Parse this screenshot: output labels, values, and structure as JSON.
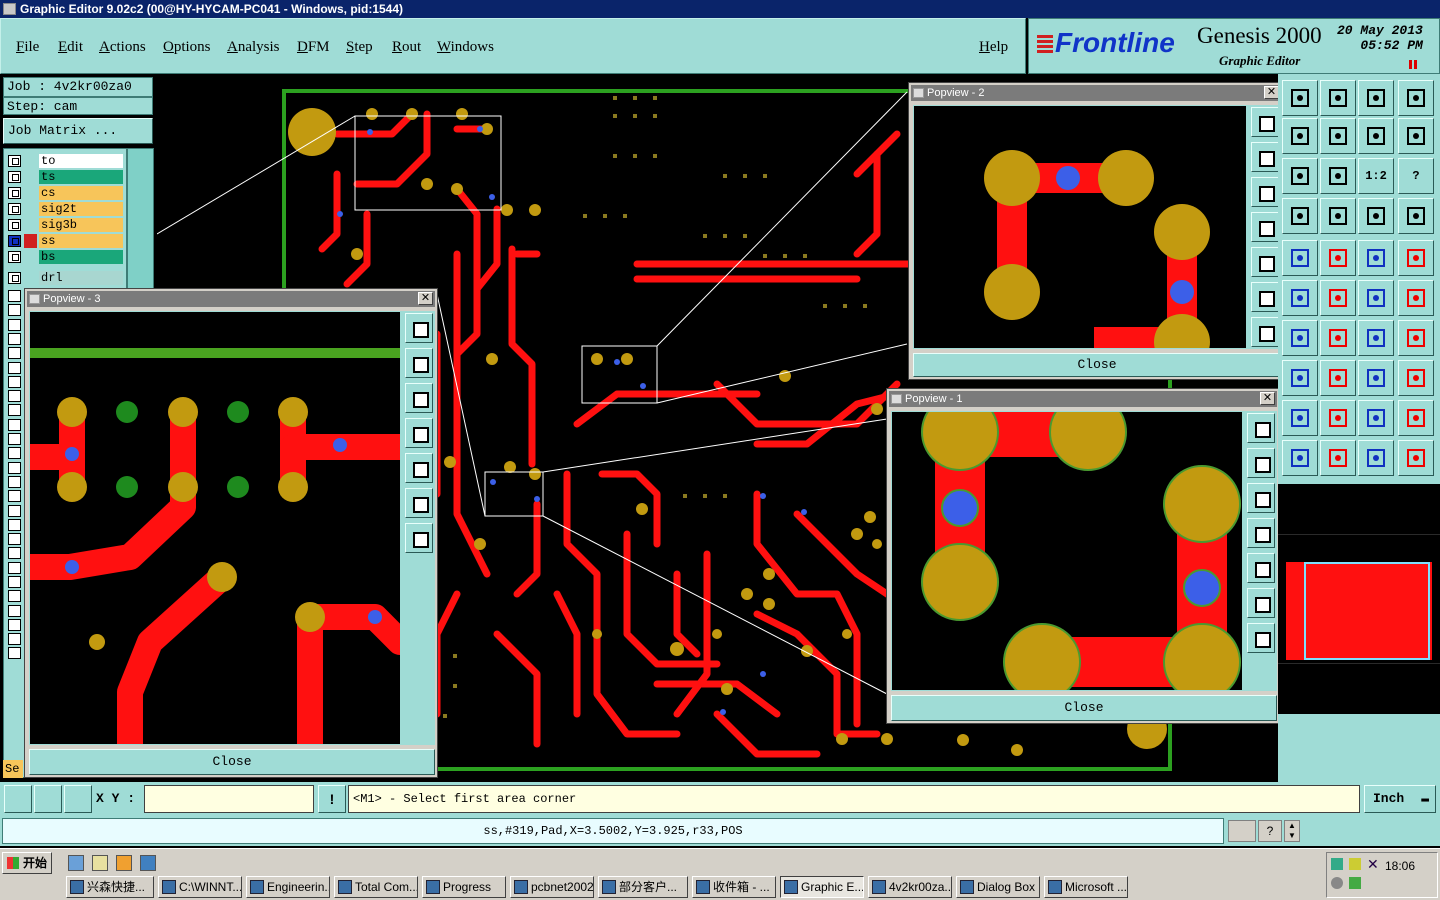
{
  "window": {
    "title": "Graphic Editor 9.02c2 (00@HY-HYCAM-PC041 - Windows, pid:1544)"
  },
  "menu": {
    "items": [
      "File",
      "Edit",
      "Actions",
      "Options",
      "Analysis",
      "DFM",
      "Step",
      "Rout",
      "Windows"
    ],
    "help": "Help"
  },
  "brand": {
    "logo": "Frontline",
    "product": "Genesis 2000",
    "subtitle": "Graphic Editor",
    "date": "20 May 2013",
    "time": "05:52 PM"
  },
  "job": {
    "job_label": "Job : 4v2kr00za0",
    "step_label": "Step: cam",
    "matrix_button": "Job Matrix ..."
  },
  "layers": [
    {
      "name": "to",
      "color": "#ffffff"
    },
    {
      "name": "ts",
      "color": "#1aa77a"
    },
    {
      "name": "cs",
      "color": "#f7c55a"
    },
    {
      "name": "sig2t",
      "color": "#f7c55a"
    },
    {
      "name": "sig3b",
      "color": "#f7c55a"
    },
    {
      "name": "ss",
      "color": "#f7c55a"
    },
    {
      "name": "bs",
      "color": "#1aa77a"
    },
    {
      "name": "drl",
      "color": "#a8d6d0"
    }
  ],
  "left_stub": "Se",
  "popviews": {
    "p3": {
      "title": "Popview - 3",
      "close": "Close"
    },
    "p2": {
      "title": "Popview - 2",
      "close": "Close"
    },
    "p1": {
      "title": "Popview - 1",
      "close": "Close"
    }
  },
  "toolbox": {
    "ratio_label": "1:2",
    "question_label": "?"
  },
  "bottom": {
    "xy_label": "X Y :",
    "xy_value": "",
    "prompt": "<M1> - Select first area corner",
    "units": "Inch"
  },
  "status": {
    "text": "ss,#319,Pad,X=3.5002,Y=3.925,r33,POS"
  },
  "taskbar": {
    "start": "开始",
    "tasks": [
      "兴森快捷...",
      "C:\\WINNT...",
      "Engineerin...",
      "Total Com...",
      "Progress",
      "pcbnet2002",
      "部分客户...",
      "收件箱 - ...",
      "Graphic E...",
      "4v2kr00za...",
      "Dialog Box",
      "Microsoft ..."
    ],
    "clock": "18:06"
  },
  "colors": {
    "trace": "#ff1010",
    "pad": "#c29a10",
    "via": "#3c5fe8",
    "board_outline": "#2ca020",
    "panel": "#9fdcd6",
    "title_active": "#0a246a",
    "title_inactive": "#7b7b7b"
  },
  "icons": {
    "close": "close-icon",
    "window": "window-icon"
  }
}
